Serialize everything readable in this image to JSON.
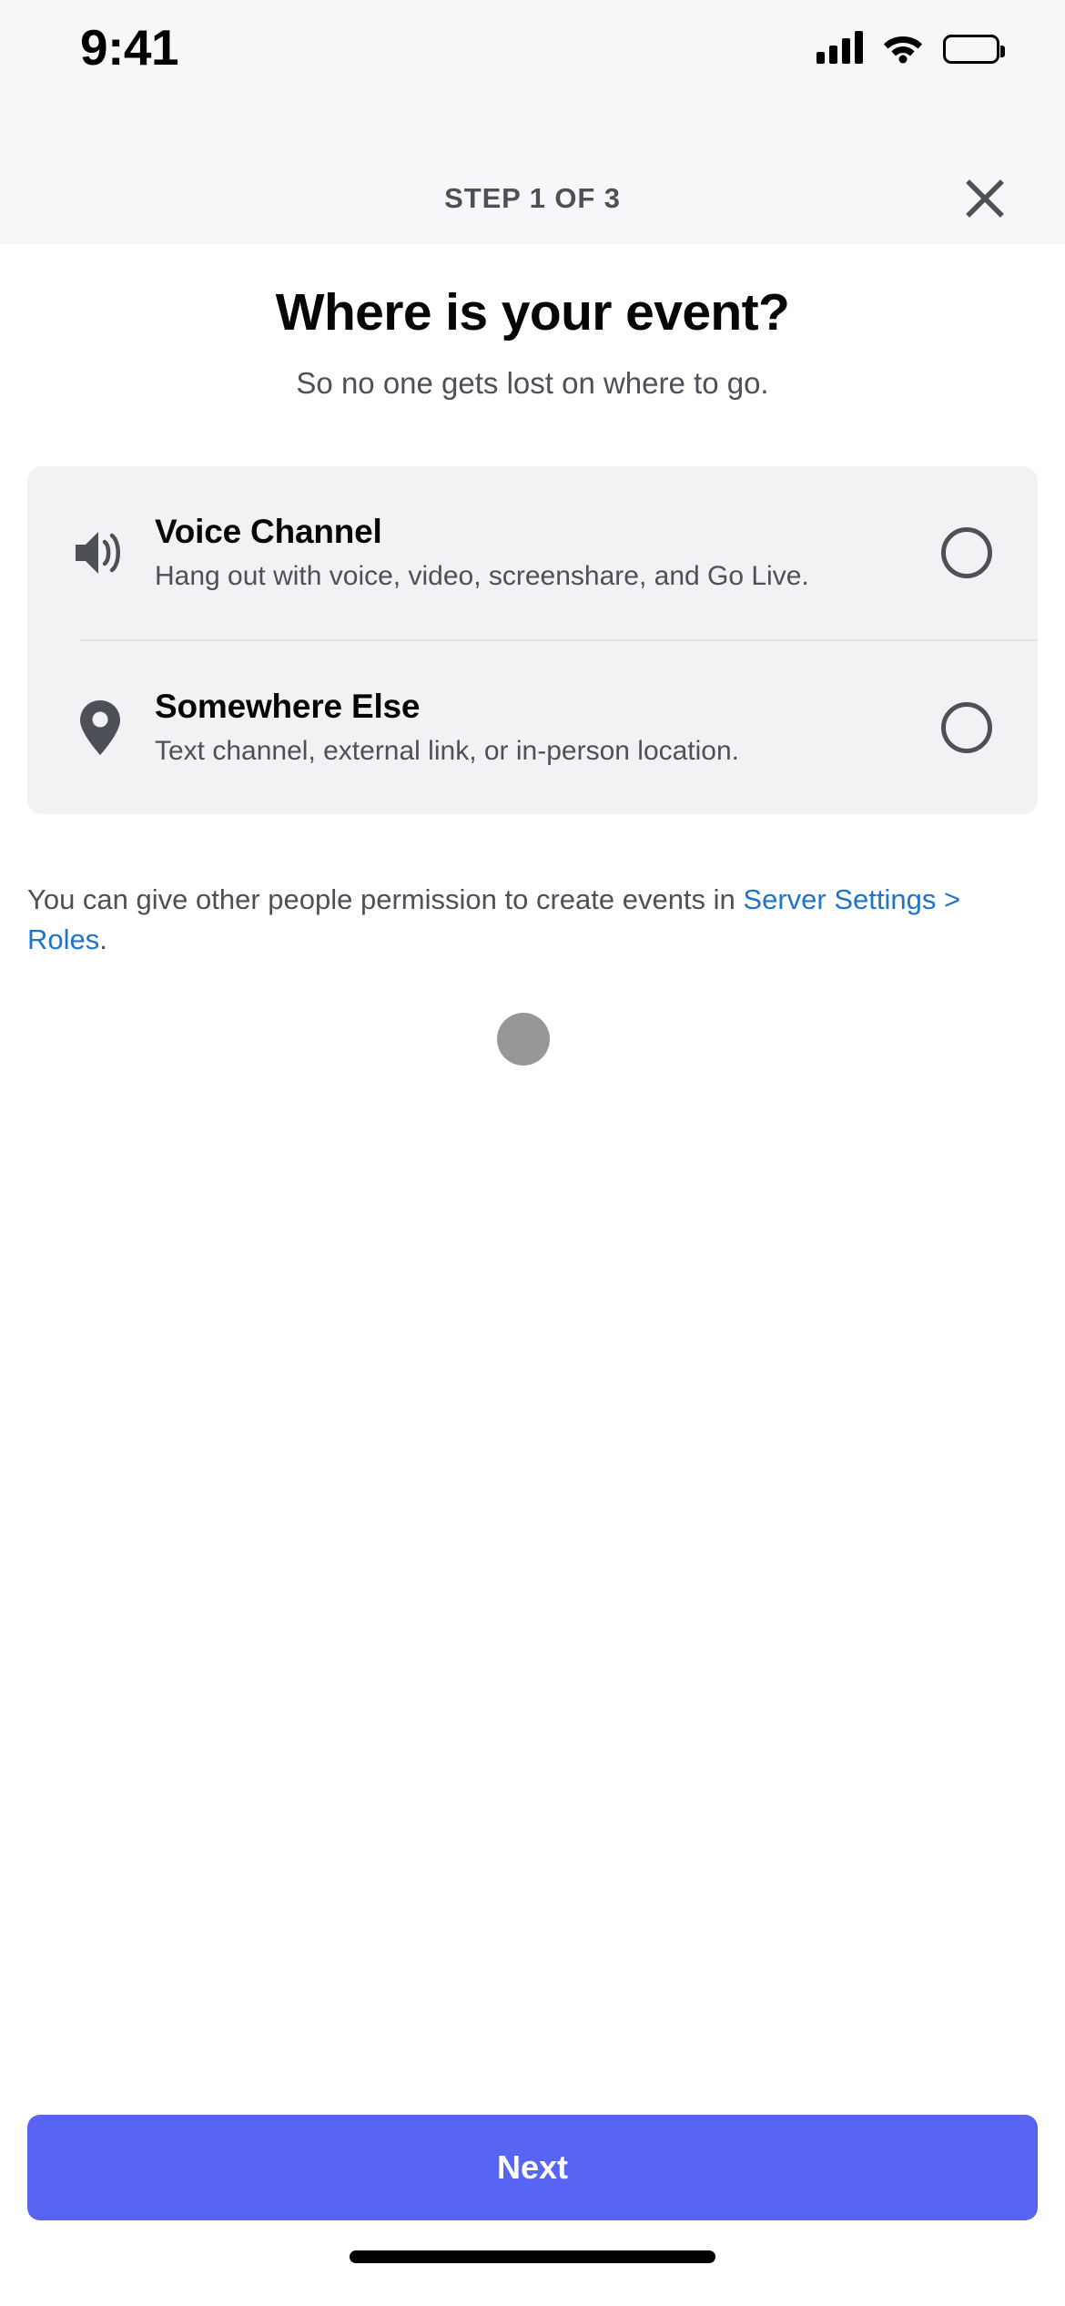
{
  "status_bar": {
    "time": "9:41",
    "signal_icon": "cellular-signal-icon",
    "wifi_icon": "wifi-icon",
    "battery_icon": "battery-full-icon"
  },
  "navbar": {
    "step_label": "STEP 1 OF 3",
    "close_icon": "close-icon"
  },
  "main": {
    "title": "Where is your event?",
    "subtitle": "So no one gets lost on where to go.",
    "options": [
      {
        "icon": "speaker-volume-icon",
        "title": "Voice Channel",
        "description": "Hang out with voice, video, screenshare, and Go Live.",
        "selected": false
      },
      {
        "icon": "location-pin-icon",
        "title": "Somewhere Else",
        "description": "Text channel, external link, or in-person location.",
        "selected": false
      }
    ],
    "helper_text_before": "You can give other people permission to create events in ",
    "helper_link": "Server Settings > Roles",
    "helper_text_after": "."
  },
  "footer": {
    "next_label": "Next"
  },
  "colors": {
    "accent": "#5865F2",
    "link": "#1D74C8",
    "card_bg": "#F2F2F5",
    "header_bg": "#F7F7FA",
    "text_primary": "#060607",
    "text_secondary": "#4E5058",
    "touch_indicator": "#8E8E8E"
  }
}
